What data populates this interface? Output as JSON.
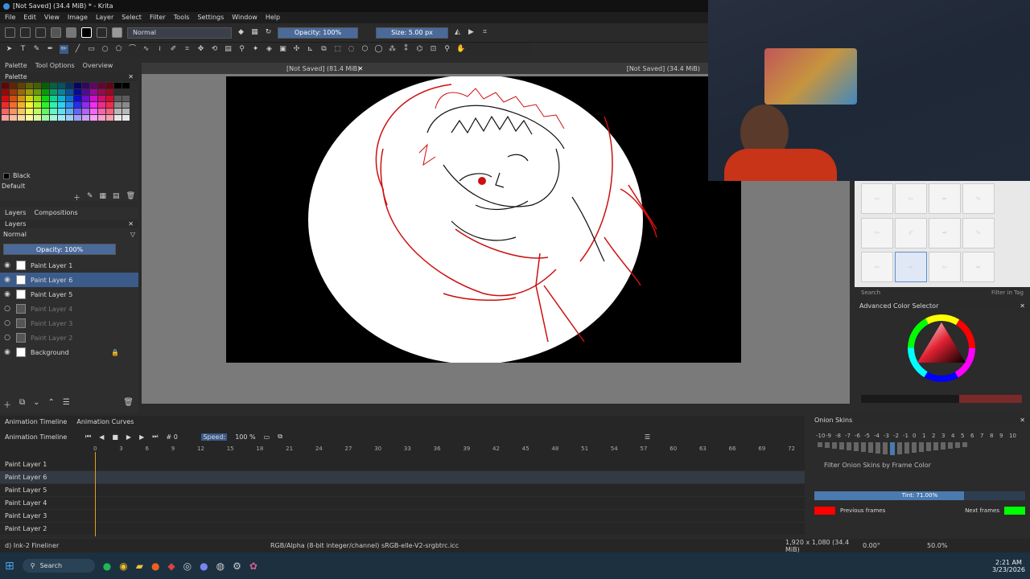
{
  "window": {
    "title": "[Not Saved] (34.4 MiB) * - Krita"
  },
  "menu": [
    "File",
    "Edit",
    "View",
    "Image",
    "Layer",
    "Select",
    "Filter",
    "Tools",
    "Settings",
    "Window",
    "Help"
  ],
  "toolbar": {
    "blend_mode": "Normal",
    "opacity": "Opacity: 100%",
    "size": "Size: 5.00 px"
  },
  "dock_tabs": [
    "Palette",
    "Tool Options",
    "Overview"
  ],
  "palette": {
    "title": "Palette",
    "color_name": "Black",
    "set_name": "Default"
  },
  "layers_panel": {
    "tabs": [
      "Layers",
      "Compositions"
    ],
    "blend": "Normal",
    "opacity": "Opacity:  100%",
    "layers": [
      {
        "name": "Paint Layer 1",
        "visible": true
      },
      {
        "name": "Paint Layer 6",
        "visible": true,
        "selected": true
      },
      {
        "name": "Paint Layer 5",
        "visible": true
      },
      {
        "name": "Paint Layer 4",
        "visible": false
      },
      {
        "name": "Paint Layer 3",
        "visible": false
      },
      {
        "name": "Paint Layer 2",
        "visible": false
      },
      {
        "name": "Background",
        "visible": true
      }
    ]
  },
  "doc_tabs": {
    "left": "[Not Saved]  (81.4 MiB)",
    "right": "[Not Saved]  (34.4 MiB)"
  },
  "timeline": {
    "tabs": [
      "Animation Timeline",
      "Animation Curves"
    ],
    "title": "Animation Timeline",
    "frame": "0",
    "speed_label": "Speed:",
    "speed": "100 %",
    "frame_numbers": [
      "0",
      "3",
      "6",
      "9",
      "12",
      "15",
      "18",
      "21",
      "24",
      "27",
      "30",
      "33",
      "36",
      "39",
      "42",
      "45",
      "48",
      "51",
      "54",
      "57",
      "60",
      "63",
      "66",
      "69",
      "72"
    ],
    "layers": [
      "Paint Layer 1",
      "Paint Layer 6",
      "Paint Layer 5",
      "Paint Layer 4",
      "Paint Layer 3",
      "Paint Layer 2"
    ]
  },
  "onion": {
    "title": "Onion Skins",
    "numbers": [
      "-10",
      "-9",
      "-8",
      "-7",
      "-6",
      "-5",
      "-4",
      "-3",
      "-2",
      "-1",
      "0",
      "1",
      "2",
      "3",
      "4",
      "5",
      "6",
      "7",
      "8",
      "9",
      "10"
    ],
    "filter_label": "Filter Onion Skins by Frame Color",
    "tint": "Tint: 71.00%",
    "tint_level": 0.71,
    "prev_label": "Previous frames",
    "next_label": "Next frames",
    "prev_color": "#ff0000",
    "next_color": "#00ff00"
  },
  "brush_panel": {
    "search_placeholder": "Search",
    "filter_in_tag": "Filter in Tag"
  },
  "color_selector": {
    "title": "Advanced Color Selector"
  },
  "status": {
    "brush": "d) Ink-2 Fineliner",
    "color_space": "RGB/Alpha (8-bit integer/channel)  sRGB-elle-V2-srgbtrc.icc",
    "dimensions": "1,920 x 1,080 (34.4 MiB)",
    "rotation": "0.00°",
    "zoom": "50.0%"
  },
  "taskbar": {
    "search": "Search",
    "time": "2:21 AM",
    "date": "3/23/2026"
  }
}
